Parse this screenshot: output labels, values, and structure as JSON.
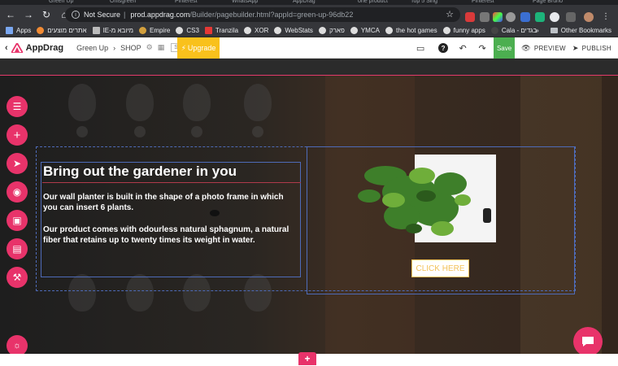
{
  "browser": {
    "tabs": [
      "Green Up",
      "Onlsgreen",
      "Pinterest",
      "WhatsApp",
      "AppDrag",
      "one product",
      "Top 5 Sing",
      "Pinterest",
      "Page Bruno"
    ],
    "url_secure_label": "Not Secure",
    "url_host": "prod.appdrag.com",
    "url_path": "/Builder/pagebuilder.html?appId=green-up-96db22",
    "bookmarks": [
      "Apps",
      "אתרים מוצעים",
      "IE-מיובא מ",
      "Empire",
      "CS3",
      "Tranzila",
      "XOR",
      "WebStats",
      "פארק",
      "YMCA",
      "the hot games",
      "funny apps",
      "Cala - בגדים"
    ],
    "bookmarks_more": "»",
    "other_bookmarks": "Other Bookmarks"
  },
  "builder": {
    "logo": "AppDrag",
    "breadcrumb_app": "Green Up",
    "breadcrumb_page": "SHOP",
    "seo": "SEO",
    "upgrade": "Upgrade",
    "save": "Save",
    "preview": "PREVIEW",
    "publish": "PUBLISH"
  },
  "hero": {
    "heading": "Bring out the gardener in you",
    "paragraph1": "Our wall planter is built  in the shape of a photo frame in which you can insert 6 plants.",
    "paragraph2": "Our product comes with odourless natural sphagnum, a natural fiber that retains up to twenty times its weight in water.",
    "cta": "CLICK HERE"
  },
  "colors": {
    "accent": "#e8336a",
    "upgrade": "#f9c11c",
    "save": "#4caf50",
    "frame": "#4e6bb8",
    "cta": "#f2c25a"
  },
  "sidebar_icons": [
    "sections-icon",
    "add-icon",
    "rocket-icon",
    "globe-icon",
    "toggle-icon",
    "archive-icon",
    "wrench-icon"
  ]
}
